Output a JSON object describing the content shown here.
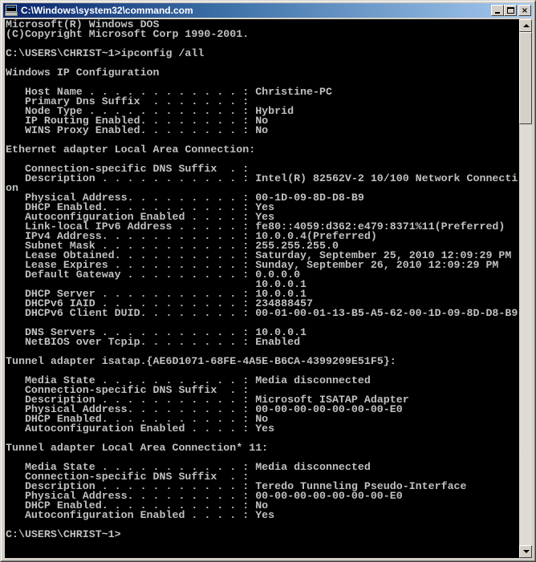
{
  "window": {
    "title": "C:\\Windows\\system32\\command.com",
    "icon": "console-window-icon",
    "buttons": {
      "minimize": "minimize-icon",
      "maximize": "maximize-icon",
      "close": "×"
    }
  },
  "scrollbar": {
    "position_fraction": 0.0,
    "visible_fraction": 0.18
  },
  "console": {
    "text_color": "#c0c0c0",
    "background_color": "#000000",
    "lines": [
      "Microsoft(R) Windows DOS",
      "(C)Copyright Microsoft Corp 1990-2001.",
      "",
      "C:\\USERS\\CHRIST~1>ipconfig /all",
      "",
      "Windows IP Configuration",
      "",
      "   Host Name . . . . . . . . . . . . : Christine-PC",
      "   Primary Dns Suffix  . . . . . . . :",
      "   Node Type . . . . . . . . . . . . : Hybrid",
      "   IP Routing Enabled. . . . . . . . : No",
      "   WINS Proxy Enabled. . . . . . . . : No",
      "",
      "Ethernet adapter Local Area Connection:",
      "",
      "   Connection-specific DNS Suffix  . :",
      "   Description . . . . . . . . . . . : Intel(R) 82562V-2 10/100 Network Connecti",
      "on",
      "   Physical Address. . . . . . . . . : 00-1D-09-8D-D8-B9",
      "   DHCP Enabled. . . . . . . . . . . : Yes",
      "   Autoconfiguration Enabled . . . . : Yes",
      "   Link-local IPv6 Address . . . . . : fe80::4059:d362:e479:8371%11(Preferred)",
      "   IPv4 Address. . . . . . . . . . . : 10.0.0.4(Preferred)",
      "   Subnet Mask . . . . . . . . . . . : 255.255.255.0",
      "   Lease Obtained. . . . . . . . . . : Saturday, September 25, 2010 12:09:29 PM",
      "   Lease Expires . . . . . . . . . . : Sunday, September 26, 2010 12:09:29 PM",
      "   Default Gateway . . . . . . . . . : 0.0.0.0",
      "                                       10.0.0.1",
      "   DHCP Server . . . . . . . . . . . : 10.0.0.1",
      "   DHCPv6 IAID . . . . . . . . . . . : 234888457",
      "   DHCPv6 Client DUID. . . . . . . . : 00-01-00-01-13-B5-A5-62-00-1D-09-8D-D8-B9",
      "",
      "   DNS Servers . . . . . . . . . . . : 10.0.0.1",
      "   NetBIOS over Tcpip. . . . . . . . : Enabled",
      "",
      "Tunnel adapter isatap.{AE6D1071-68FE-4A5E-B6CA-4399209E51F5}:",
      "",
      "   Media State . . . . . . . . . . . : Media disconnected",
      "   Connection-specific DNS Suffix  . :",
      "   Description . . . . . . . . . . . : Microsoft ISATAP Adapter",
      "   Physical Address. . . . . . . . . : 00-00-00-00-00-00-00-E0",
      "   DHCP Enabled. . . . . . . . . . . : No",
      "   Autoconfiguration Enabled . . . . : Yes",
      "",
      "Tunnel adapter Local Area Connection* 11:",
      "",
      "   Media State . . . . . . . . . . . : Media disconnected",
      "   Connection-specific DNS Suffix  . :",
      "   Description . . . . . . . . . . . : Teredo Tunneling Pseudo-Interface",
      "   Physical Address. . . . . . . . . : 00-00-00-00-00-00-00-E0",
      "   DHCP Enabled. . . . . . . . . . . : No",
      "   Autoconfiguration Enabled . . . . : Yes",
      "",
      "C:\\USERS\\CHRIST~1>"
    ]
  }
}
